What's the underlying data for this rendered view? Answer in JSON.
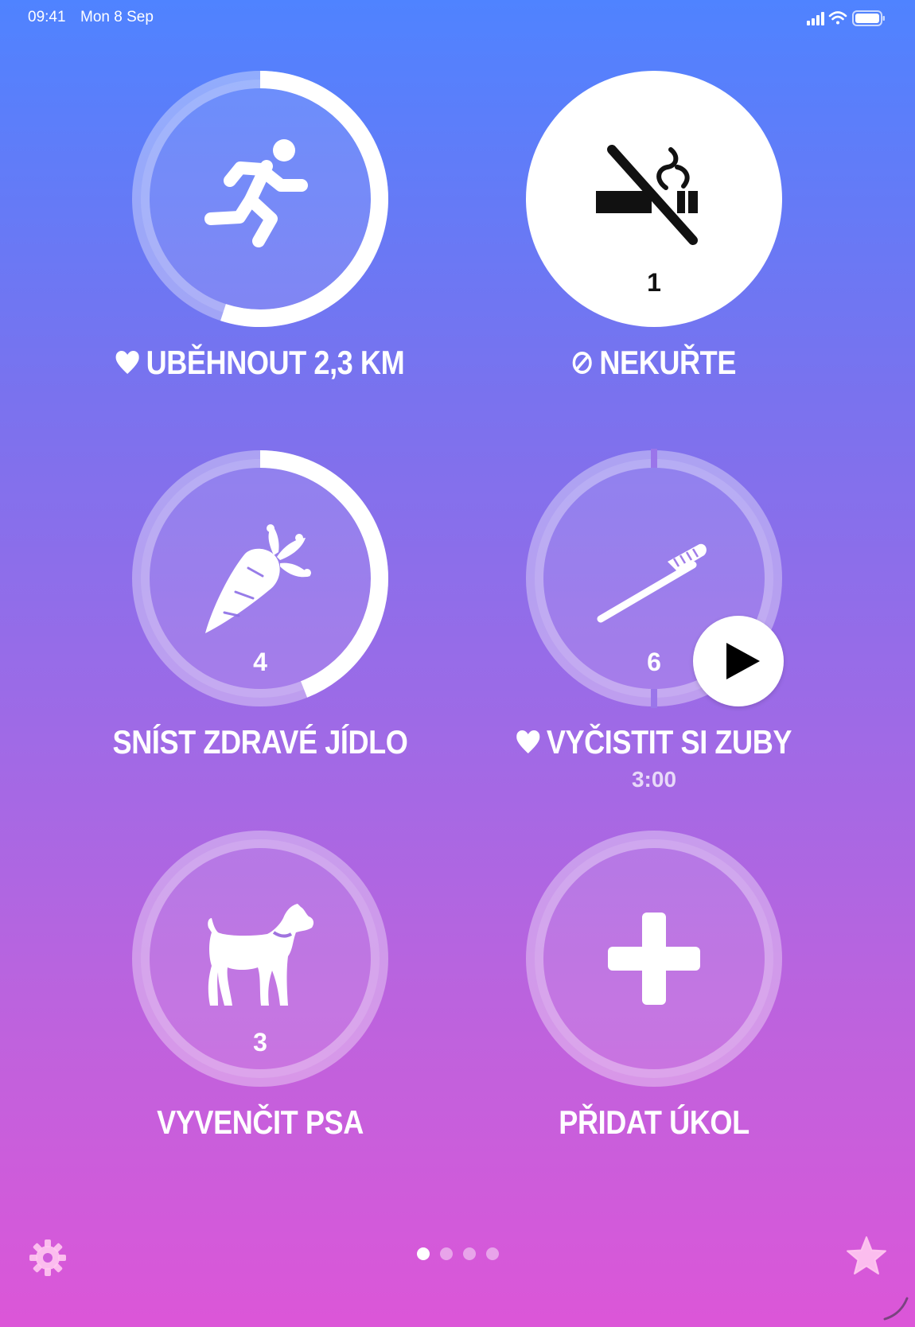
{
  "status_bar": {
    "time": "09:41",
    "date": "Mon 8 Sep"
  },
  "colors": {
    "accent": "#ffffff",
    "track": "rgba(255,255,255,0.35)"
  },
  "tasks": [
    {
      "label": "UBĚHNOUT 2,3 KM",
      "prefix_icon": "heart-icon",
      "icon": "running-person-icon",
      "count": "",
      "progress": 0.55,
      "done": false
    },
    {
      "label": "NEKUŘTE",
      "prefix_icon": "prohibited-icon",
      "icon": "no-smoking-icon",
      "count": "1",
      "done": true
    },
    {
      "label": "SNÍST ZDRAVÉ JÍDLO",
      "icon": "carrot-icon",
      "count": "4",
      "progress": 0.44,
      "done": false
    },
    {
      "label": "VYČISTIT SI ZUBY",
      "prefix_icon": "heart-icon",
      "icon": "toothbrush-icon",
      "count": "6",
      "sublabel": "3:00",
      "segments": 2,
      "done": false
    },
    {
      "label": "VYVENČIT PSA",
      "icon": "dog-icon",
      "count": "3",
      "done": false
    },
    {
      "label": "PŘIDAT ÚKOL",
      "icon": "plus-icon",
      "count": "",
      "done": false
    }
  ],
  "pager": {
    "pages": 4,
    "current": 1
  },
  "toolbar": {
    "settings": "gear-icon",
    "favorites": "star-icon"
  }
}
